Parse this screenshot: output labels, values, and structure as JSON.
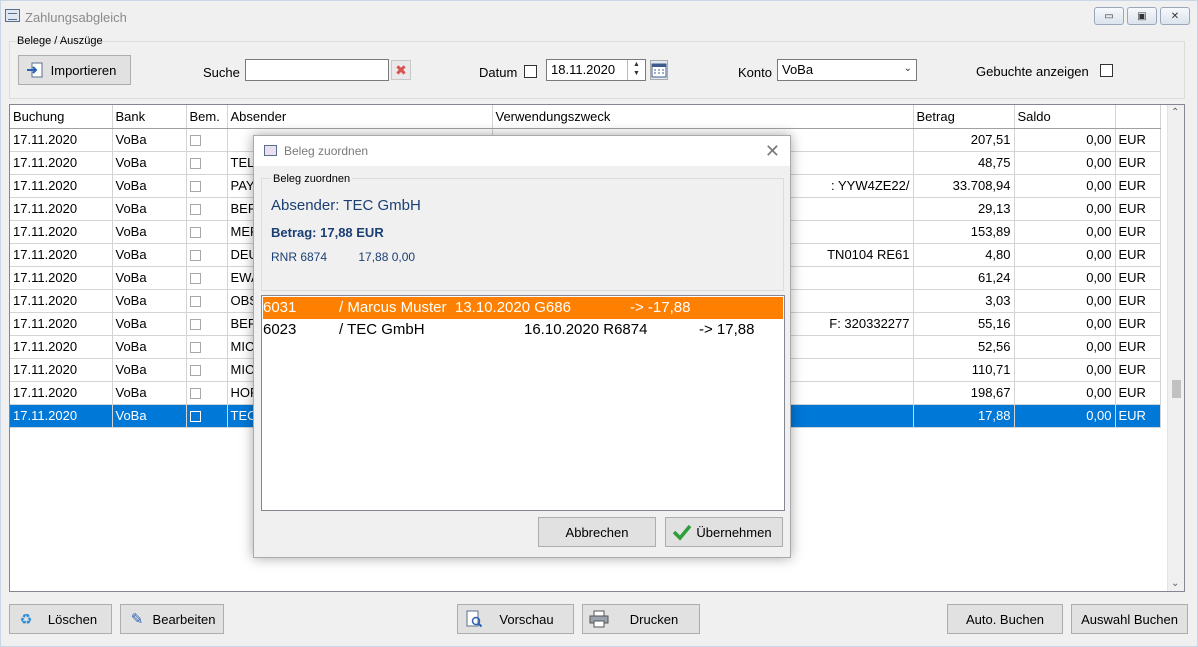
{
  "window": {
    "title": "Zahlungsabgleich",
    "controls": [
      "minimize-icon",
      "maximize-icon",
      "close-icon"
    ]
  },
  "toolbar": {
    "group_label": "Belege / Auszüge",
    "import_label": "Importieren",
    "search_label": "Suche",
    "search_value": "",
    "date_label": "Datum",
    "date_checked": false,
    "date_value": "18.11.2020",
    "account_label": "Konto",
    "account_value": "VoBa",
    "show_booked_label": "Gebuchte anzeigen",
    "show_booked_checked": false
  },
  "grid": {
    "columns": [
      "Buchung",
      "Bank",
      "Bem.",
      "Absender",
      "Verwendungszweck",
      "Betrag",
      "Saldo",
      ""
    ],
    "rows": [
      {
        "buchung": "17.11.2020",
        "bank": "VoBa",
        "absender": "",
        "zweck": "",
        "betrag": "207,51",
        "saldo": "0,00",
        "cur": "EUR",
        "selected": false
      },
      {
        "buchung": "17.11.2020",
        "bank": "VoBa",
        "absender": "TEL",
        "zweck": "",
        "betrag": "48,75",
        "saldo": "0,00",
        "cur": "EUR",
        "selected": false
      },
      {
        "buchung": "17.11.2020",
        "bank": "VoBa",
        "absender": "PAY",
        "zweck": ": YYW4ZE22/",
        "betrag": "33.708,94",
        "saldo": "0,00",
        "cur": "EUR",
        "selected": false
      },
      {
        "buchung": "17.11.2020",
        "bank": "VoBa",
        "absender": "BER",
        "zweck": "",
        "betrag": "29,13",
        "saldo": "0,00",
        "cur": "EUR",
        "selected": false
      },
      {
        "buchung": "17.11.2020",
        "bank": "VoBa",
        "absender": "MER",
        "zweck": "",
        "betrag": "153,89",
        "saldo": "0,00",
        "cur": "EUR",
        "selected": false
      },
      {
        "buchung": "17.11.2020",
        "bank": "VoBa",
        "absender": "DEU",
        "zweck": "TN0104 RE61",
        "betrag": "4,80",
        "saldo": "0,00",
        "cur": "EUR",
        "selected": false
      },
      {
        "buchung": "17.11.2020",
        "bank": "VoBa",
        "absender": "EWA",
        "zweck": "",
        "betrag": "61,24",
        "saldo": "0,00",
        "cur": "EUR",
        "selected": false
      },
      {
        "buchung": "17.11.2020",
        "bank": "VoBa",
        "absender": "OBS",
        "zweck": "",
        "betrag": "3,03",
        "saldo": "0,00",
        "cur": "EUR",
        "selected": false
      },
      {
        "buchung": "17.11.2020",
        "bank": "VoBa",
        "absender": "BER",
        "zweck": "F: 320332277",
        "betrag": "55,16",
        "saldo": "0,00",
        "cur": "EUR",
        "selected": false
      },
      {
        "buchung": "17.11.2020",
        "bank": "VoBa",
        "absender": "MIC",
        "zweck": "",
        "betrag": "52,56",
        "saldo": "0,00",
        "cur": "EUR",
        "selected": false
      },
      {
        "buchung": "17.11.2020",
        "bank": "VoBa",
        "absender": "MIC",
        "zweck": "",
        "betrag": "110,71",
        "saldo": "0,00",
        "cur": "EUR",
        "selected": false
      },
      {
        "buchung": "17.11.2020",
        "bank": "VoBa",
        "absender": "HOF",
        "zweck": "",
        "betrag": "198,67",
        "saldo": "0,00",
        "cur": "EUR",
        "selected": false
      },
      {
        "buchung": "17.11.2020",
        "bank": "VoBa",
        "absender": "TEC",
        "zweck": "",
        "betrag": "17,88",
        "saldo": "0,00",
        "cur": "EUR",
        "selected": true
      }
    ]
  },
  "bottom": {
    "delete_label": "Löschen",
    "edit_label": "Bearbeiten",
    "preview_label": "Vorschau",
    "print_label": "Drucken",
    "auto_book_label": "Auto. Buchen",
    "book_selection_label": "Auswahl Buchen"
  },
  "dialog": {
    "title": "Beleg zuordnen",
    "group_title": "Beleg zuordnen",
    "absender": "Absender: TEC GmbH",
    "betrag": "Betrag: 17,88 EUR",
    "rnr": "RNR 6874",
    "rnr_values": "17,88 0,00",
    "items": [
      {
        "nr": "6031",
        "name": "/ Marcus Muster",
        "date_ref": "13.10.2020 G686",
        "amount": "-> -17,88",
        "highlight": true
      },
      {
        "nr": "6023",
        "name": "/ TEC GmbH",
        "date_ref": "16.10.2020 R6874",
        "amount": "-> 17,88",
        "highlight": false
      }
    ],
    "cancel_label": "Abbrechen",
    "accept_label": "Übernehmen"
  },
  "colors": {
    "selection": "#0078d7",
    "highlight": "#ff8000",
    "dialog_text": "#1b3f73"
  }
}
